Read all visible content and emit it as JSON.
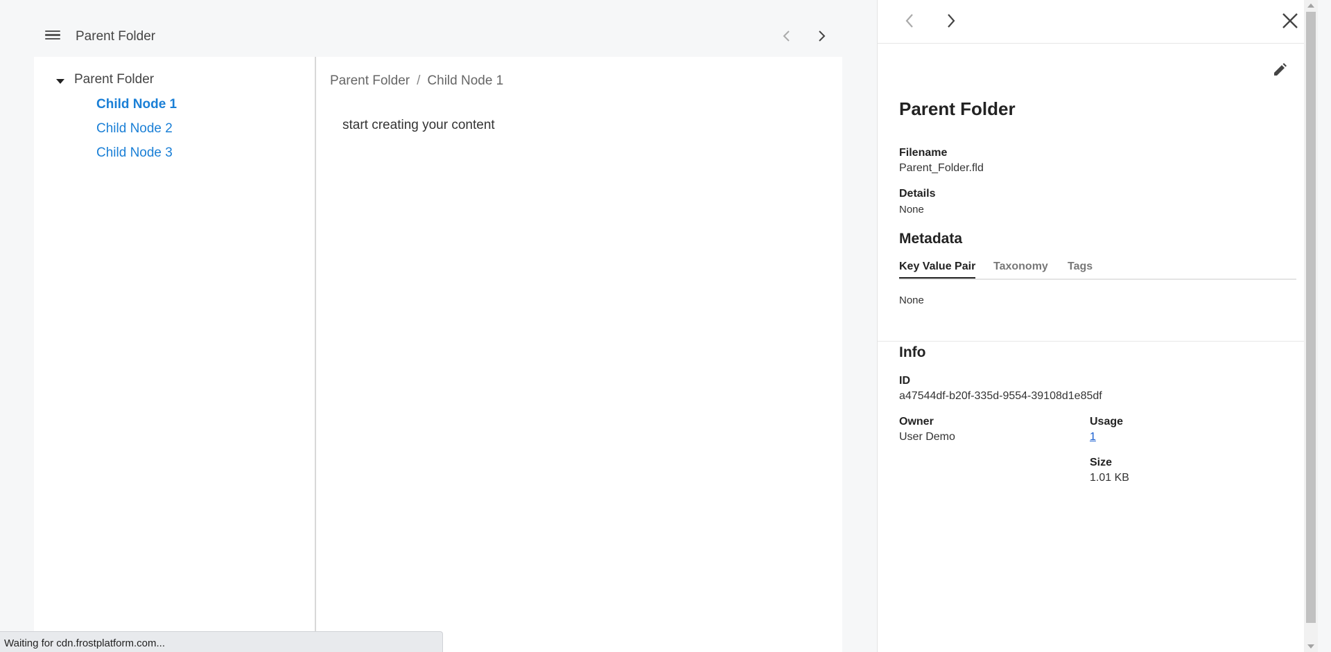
{
  "topbar": {
    "title": "Parent Folder",
    "menu_icon": "hamburger-menu-icon",
    "prev_icon": "chevron-left-icon",
    "next_icon": "chevron-right-icon"
  },
  "tree": {
    "root_label": "Parent Folder",
    "children": [
      {
        "label": "Child Node 1",
        "active": true
      },
      {
        "label": "Child Node 2",
        "active": false
      },
      {
        "label": "Child Node 3",
        "active": false
      }
    ]
  },
  "main": {
    "breadcrumb": [
      "Parent Folder",
      "Child Node 1"
    ],
    "breadcrumb_separator": "/",
    "content": "start creating your content"
  },
  "panel": {
    "title": "Parent Folder",
    "filename_label": "Filename",
    "filename_value": "Parent_Folder.fld",
    "details_label": "Details",
    "details_value": "None",
    "metadata_title": "Metadata",
    "tabs": [
      {
        "label": "Key Value Pair",
        "active": true
      },
      {
        "label": "Taxonomy",
        "active": false
      },
      {
        "label": "Tags",
        "active": false
      }
    ],
    "metadata_value": "None",
    "info_title": "Info",
    "id_label": "ID",
    "id_value": "a47544df-b20f-335d-9554-39108d1e85df",
    "owner_label": "Owner",
    "owner_value": "User Demo",
    "usage_label": "Usage",
    "usage_value": "1",
    "size_label": "Size",
    "size_value": "1.01 KB"
  },
  "status": {
    "text": "Waiting for cdn.frostplatform.com..."
  },
  "colors": {
    "link": "#1a7fd6",
    "page_bg": "#f6f7f8",
    "panel_bg": "#ffffff"
  }
}
